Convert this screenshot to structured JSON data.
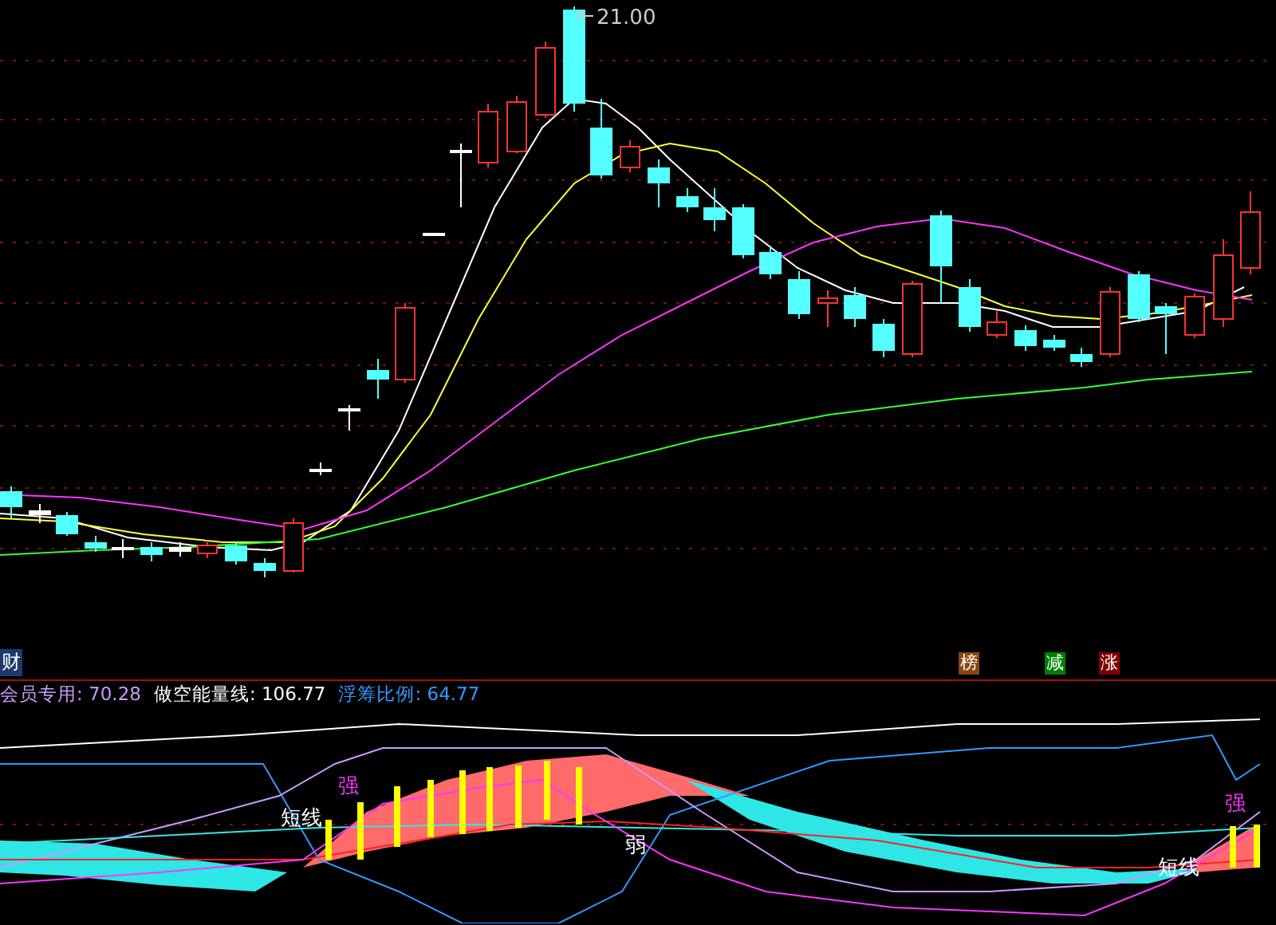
{
  "price_panel": {
    "high_label": "21.00"
  },
  "panel_tag": "财",
  "badges": [
    {
      "text": "榜",
      "color": "#8b4513"
    },
    {
      "text": "减",
      "color": "#008000"
    },
    {
      "text": "涨",
      "color": "#800000"
    }
  ],
  "indicators": [
    {
      "name": "会员专用:",
      "value": "70.28",
      "color": "#cc99ff"
    },
    {
      "name": "做空能量线:",
      "value": "106.77",
      "color": "#ffffff"
    },
    {
      "name": "浮筹比例:",
      "value": "64.77",
      "color": "#3399ff"
    }
  ],
  "annotations": [
    {
      "text": "强",
      "kind": "strong"
    },
    {
      "text": "短线",
      "kind": "short"
    },
    {
      "text": "弱",
      "kind": "weak"
    },
    {
      "text": "短线",
      "kind": "short"
    },
    {
      "text": "强",
      "kind": "strong"
    }
  ]
}
